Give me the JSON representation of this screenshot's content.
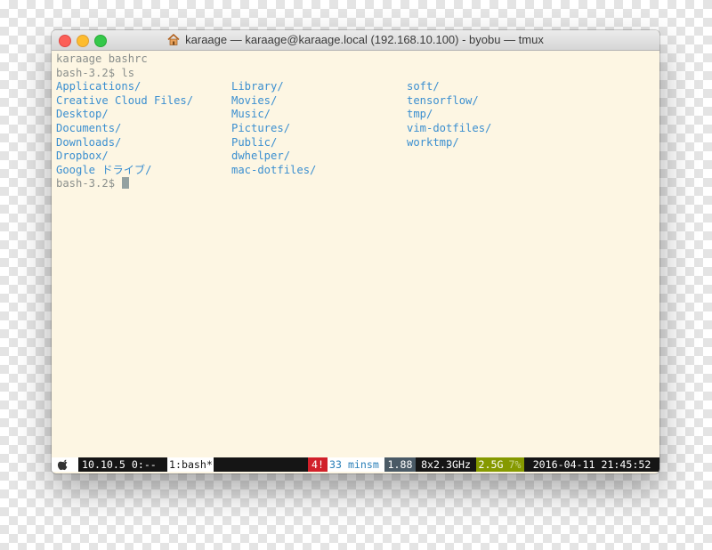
{
  "window": {
    "title": "karaage — karaage@karaage.local (192.168.10.100) - byobu — tmux",
    "title_icon": "home-icon"
  },
  "terminal": {
    "lines": [
      "karaage bashrc",
      "bash-3.2$ ls"
    ],
    "ls_columns": [
      [
        "Applications/",
        "Creative Cloud Files/",
        "Desktop/",
        "Documents/",
        "Downloads/",
        "Dropbox/",
        "Google ドライブ/"
      ],
      [
        "Library/",
        "Movies/",
        "Music/",
        "Pictures/",
        "Public/",
        "dwhelper/",
        "mac-dotfiles/"
      ],
      [
        "soft/",
        "tensorflow/",
        "tmp/",
        "vim-dotfiles/",
        "worktmp/"
      ]
    ],
    "prompt": "bash-3.2$ "
  },
  "statusbar": {
    "os_icon": "apple-icon",
    "os_version": "10.10.5",
    "session": "0:--",
    "window": "1:bash*",
    "updates": "4!",
    "uptime": "33 minsm",
    "load": "1.88",
    "cpu": "8x2.3GHz",
    "memory": "2.5G",
    "memory_pct": "7%",
    "datetime": "2016-04-11 21:45:52"
  },
  "colors": {
    "background": "#fdf6e3",
    "foreground": "#8a8f8c",
    "directory": "#3b8fd0",
    "status_dark": "#151515",
    "status_red": "#d1202a",
    "status_blue": "#2a7fb8",
    "status_teal": "#2aa198",
    "status_olive": "#859900"
  }
}
